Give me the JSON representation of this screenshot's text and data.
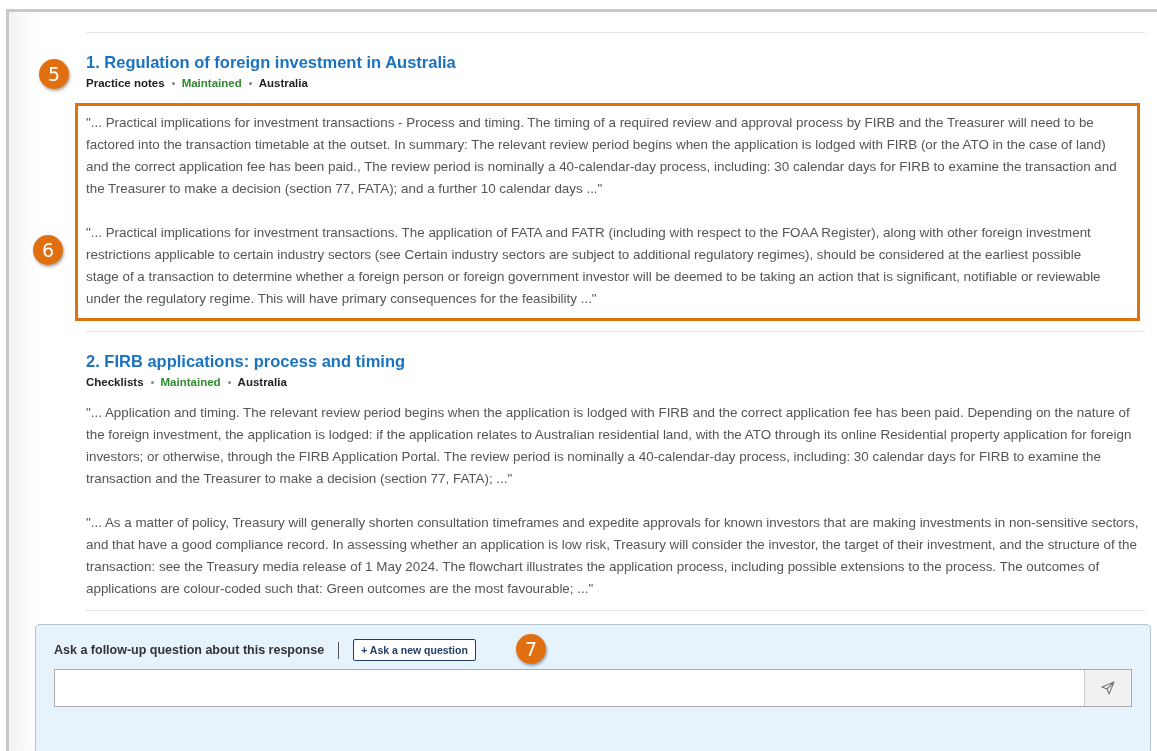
{
  "results": [
    {
      "title": "1. Regulation of foreign investment in Australia",
      "callout": "5",
      "meta": [
        {
          "text": "Practice notes",
          "kind": "type"
        },
        {
          "text": "Maintained",
          "kind": "status"
        },
        {
          "text": "Australia",
          "kind": "jurisdiction"
        }
      ],
      "highlighted": true,
      "highlight_callout": "6",
      "excerpts": [
        "\"... Practical implications for investment transactions - Process and timing. The timing of a required review and approval process by FIRB and the Treasurer will need to be factored into the transaction timetable at the outset. In summary: The relevant review period begins when the application is lodged with FIRB (or the ATO in the case of land) and the correct application fee has been paid., The review period is nominally a 40-calendar-day process, including: 30 calendar days for FIRB to examine the transaction and the Treasurer to make a decision (section 77, FATA); and a further 10 calendar days ...\"",
        "\"... Practical implications for investment transactions. The application of FATA and FATR (including with respect to the FOAA Register), along with other foreign investment restrictions applicable to certain industry sectors (see Certain industry sectors are subject to additional regulatory regimes), should be considered at the earliest possible stage of a transaction to determine whether a foreign person or foreign government investor will be deemed to be taking an action that is significant, notifiable or reviewable under the regulatory regime. This will have primary consequences for the feasibility ...\""
      ]
    },
    {
      "title": "2. FIRB applications: process and timing",
      "meta": [
        {
          "text": "Checklists",
          "kind": "type"
        },
        {
          "text": "Maintained",
          "kind": "status"
        },
        {
          "text": "Australia",
          "kind": "jurisdiction"
        }
      ],
      "highlighted": false,
      "excerpts": [
        "\"... Application and timing. The relevant review period begins when the application is lodged with FIRB and the correct application fee has been paid. Depending on the nature of the foreign investment, the application is lodged: if the application relates to Australian residential land, with the ATO through its online Residential property application for foreign investors; or otherwise, through the FIRB Application Portal. The review period is nominally a 40-calendar-day process, including: 30 calendar days for FIRB to examine the transaction and the Treasurer to make a decision (section 77, FATA); ...\"",
        "\"... As a matter of policy, Treasury will generally shorten consultation timeframes and expedite approvals for known investors that are making investments in non-sensitive sectors, and that have a good compliance record. In assessing whether an application is low risk, Treasury will consider the investor, the target of their investment, and the structure of the transaction: see the Treasury media release of 1 May 2024. The flowchart illustrates the application process, including possible extensions to the process. The outcomes of applications are colour-coded such that: Green outcomes are the most favourable; ...\""
      ]
    }
  ],
  "followup": {
    "label": "Ask a follow-up question about this response",
    "new_question_button": "+ Ask a new question",
    "callout": "7"
  }
}
